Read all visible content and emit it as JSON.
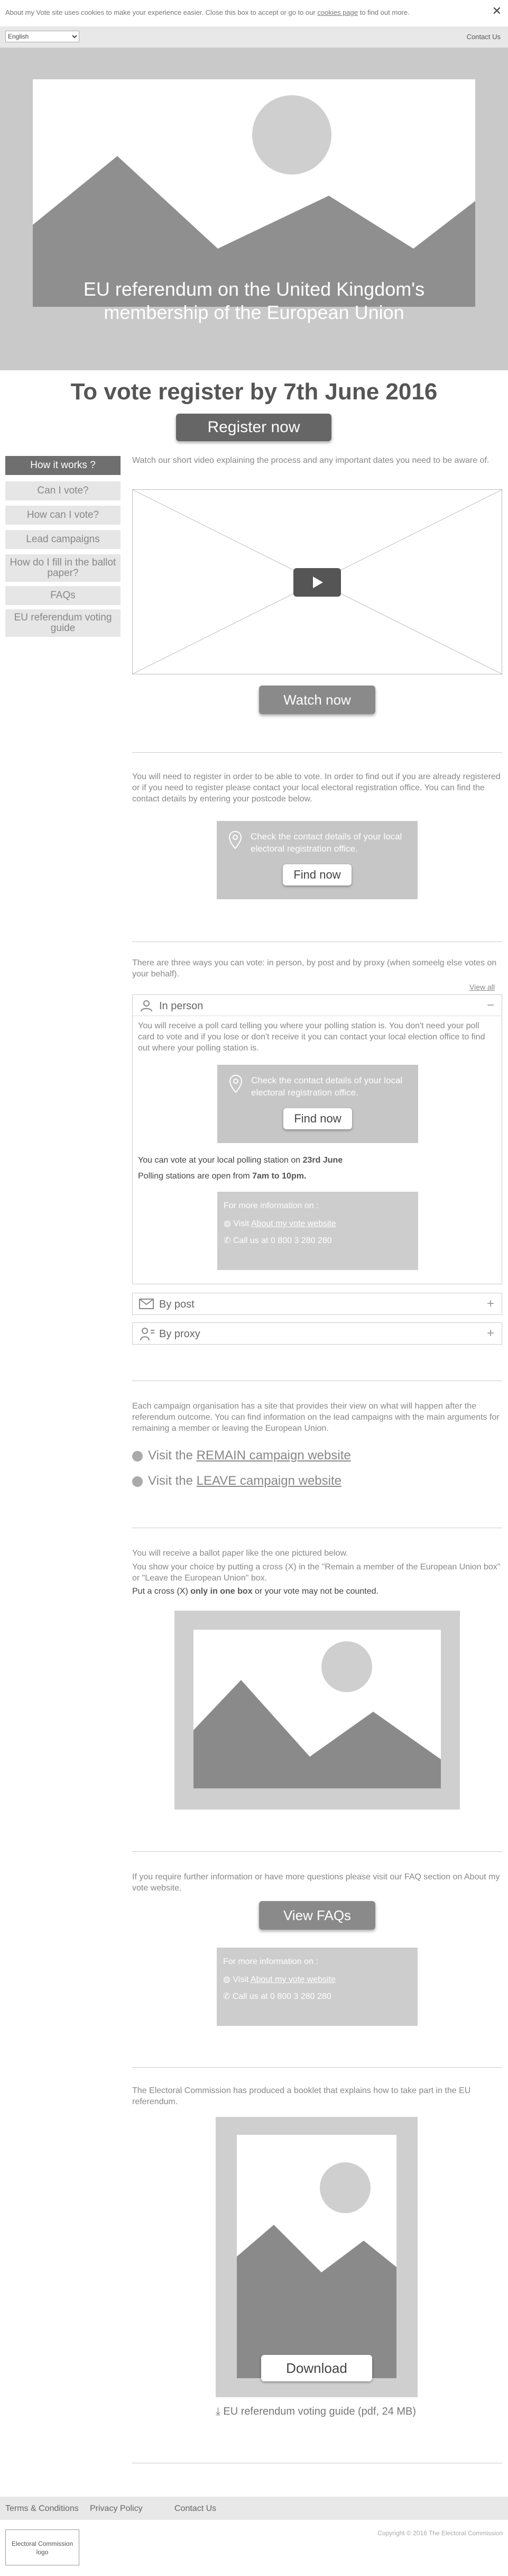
{
  "cookie": {
    "text": "About my Vote site uses cookies to make your experience easier. Close this box to accept or go to our ",
    "link": "cookies page",
    "suffix": " to find out more.",
    "close": "✕"
  },
  "topbar": {
    "language": "English",
    "contact": "Contact Us"
  },
  "hero": {
    "title": "EU referendum on the United Kingdom's membership of the European Union"
  },
  "register": {
    "heading": "To vote register by 7th June 2016",
    "button": "Register now"
  },
  "sidebar": {
    "items": [
      {
        "label": "How it works ?",
        "active": true
      },
      {
        "label": "Can I vote?"
      },
      {
        "label": "How can I vote?"
      },
      {
        "label": "Lead campaigns"
      },
      {
        "label": "How do I fill in the ballot paper?"
      },
      {
        "label": "FAQs"
      },
      {
        "label": "EU referendum voting guide"
      }
    ]
  },
  "video": {
    "intro": "Watch our short video explaining the process and any important dates you need to be aware of.",
    "button": "Watch now"
  },
  "register_info": {
    "text": "You will need to register in order to be able to vote. In order to find out if you are already registered or if you need to register please contact your local electoral registration office. You can find the contact details by entering your postcode below.",
    "box_text": "Check the contact details of your local electoral registration office.",
    "button": "Find now"
  },
  "ways": {
    "text": "There are three ways you can vote: in person, by post and by proxy (when someelg else votes on your behalf).",
    "view_all": "View all",
    "in_person": {
      "label": "In person",
      "sign": "−",
      "text": "You will receive a poll card telling you where your polling station is. You don't need your poll card to vote and if you lose or don't receive it you can contact your local election office to find out where your polling station is.",
      "box_text": "Check the contact details of your local electoral registration office.",
      "button": "Find now",
      "date_prefix": "You can vote at your local polling station on ",
      "date": "23rd June",
      "hours_prefix": "Polling stations are open from ",
      "hours": "7am to 10pm.",
      "more_info": "For more information on :",
      "visit_prefix": "Visit ",
      "visit_link": "About my vote website",
      "call": "Call us at 0 800 3 280 280"
    },
    "by_post": {
      "label": "By post",
      "sign": "+"
    },
    "by_proxy": {
      "label": "By proxy",
      "sign": "+"
    }
  },
  "campaigns": {
    "text": "Each campaign organisation has a site that provides their view on what will happen after the referendum outcome. You can find information on the lead campaigns with the main arguments for remaining a member or leaving the European Union.",
    "remain_prefix": "Visit the ",
    "remain_link": "REMAIN campaign website",
    "leave_prefix": "Visit the ",
    "leave_link": "LEAVE campaign website"
  },
  "ballot": {
    "line1": "You will receive a ballot paper  like the one pictured below.",
    "line2": "You show your choice by putting a cross (X) in the \"Remain a member of the European Union box\" or \"Leave the European Union\" box.",
    "line3_prefix": "Put a cross (X) ",
    "line3_bold": "only in one box",
    "line3_suffix": " or your vote may not be counted."
  },
  "faq": {
    "text": "If you require further information or have more questions please visit our FAQ section on About my vote website.",
    "button": "View FAQs",
    "more_info": "For more information on :",
    "visit_prefix": "Visit ",
    "visit_link": "About my vote website",
    "call": "Call us at 0 800 3 280 280"
  },
  "booklet": {
    "text": "The Electoral Commission has produced a booklet that explains how to take part in the EU referendum.",
    "button": "Download",
    "link": "EU referendum voting guide (pdf, 24 MB)"
  },
  "footer": {
    "terms": "Terms & Conditions",
    "privacy": "Privacy Policy",
    "contact": "Contact Us",
    "copyright": "Copyright © 2016 The Electoral Commission",
    "logo": "Electoral Commission logo"
  },
  "colors": {
    "hero_bg": "#c9c9c9",
    "button_dark": "#666666",
    "placeholder": "#8a8a8a"
  }
}
